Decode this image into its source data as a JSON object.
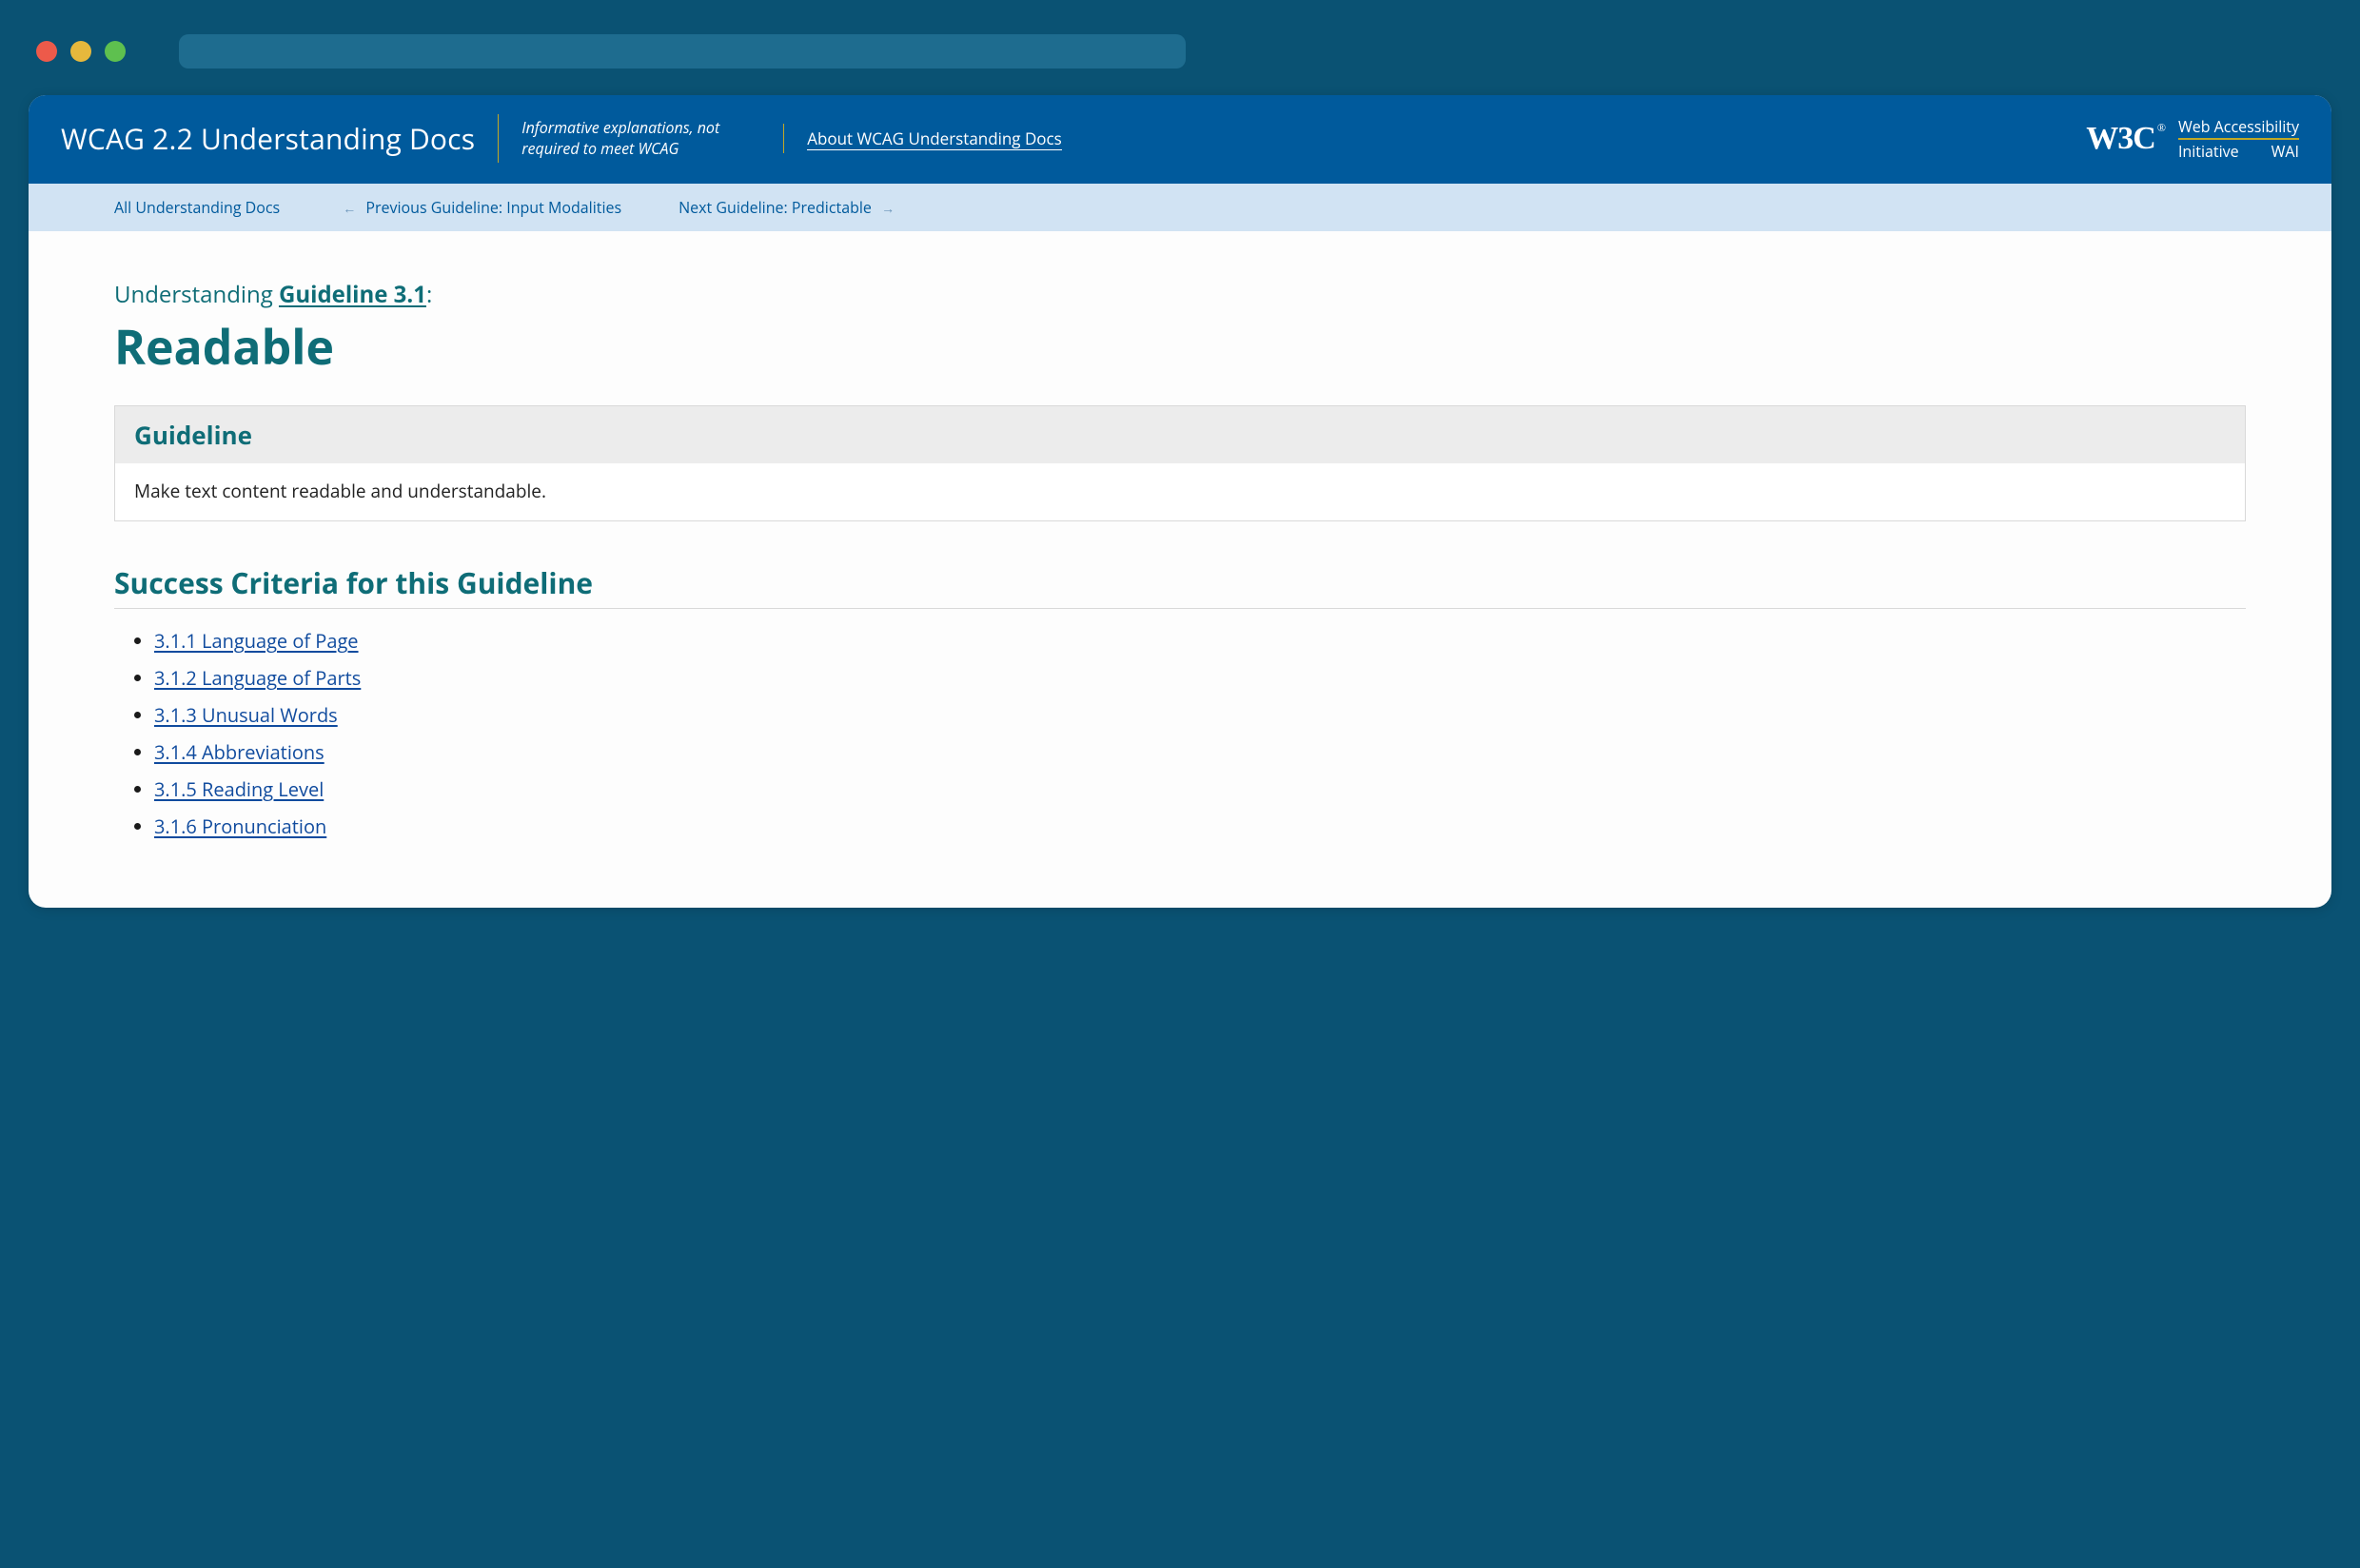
{
  "header": {
    "title": "WCAG 2.2 Understanding Docs",
    "tagline": "Informative explanations, not required to meet WCAG",
    "about_link": "About WCAG Understanding Docs",
    "logo": {
      "mark": "W3C",
      "reg": "®",
      "line1": "Web Accessibility",
      "line2a": "Initiative",
      "line2b": "WAI"
    }
  },
  "nav": {
    "all_docs": "All Understanding Docs",
    "prev_full": "Previous Guideline: Input Modalities",
    "next_full": "Next Guideline: Predictable"
  },
  "page": {
    "kicker_pre": "Understanding ",
    "kicker_link": "Guideline 3.1",
    "kicker_post": ":",
    "title": "Readable"
  },
  "guideline_box": {
    "heading": "Guideline",
    "text": "Make text content readable and understandable."
  },
  "sc_section_title": "Success Criteria for this Guideline",
  "success_criteria": [
    "3.1.1 Language of Page",
    "3.1.2 Language of Parts",
    "3.1.3 Unusual Words",
    "3.1.4 Abbreviations",
    "3.1.5 Reading Level",
    "3.1.6 Pronunciation"
  ]
}
